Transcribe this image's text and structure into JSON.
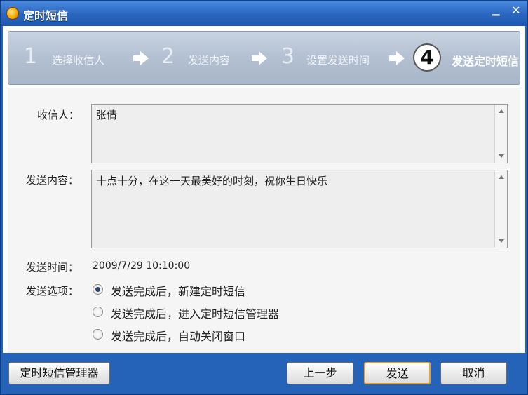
{
  "window": {
    "title": "定时短信",
    "minimize_glyph": "▁",
    "close_glyph": "✕"
  },
  "wizard": {
    "steps": [
      {
        "number": "1",
        "label": "选择收信人"
      },
      {
        "number": "2",
        "label": "发送内容"
      },
      {
        "number": "3",
        "label": "设置发送时间"
      },
      {
        "number": "4",
        "label": "发送定时短信",
        "active": true
      }
    ]
  },
  "form": {
    "recipients_label": "收信人：",
    "recipients_value": "张倩",
    "content_label": "发送内容：",
    "content_value": "十点十分，在这一天最美好的时刻，祝你生日快乐",
    "time_label": "发送时间：",
    "time_value": "2009/7/29 10:10:00",
    "options_label": "发送选项：",
    "options": [
      {
        "label": "发送完成后，新建定时短信",
        "selected": true
      },
      {
        "label": "发送完成后，进入定时短信管理器",
        "selected": false
      },
      {
        "label": "发送完成后，自动关闭窗口",
        "selected": false
      }
    ]
  },
  "buttons": {
    "manager": "定时短信管理器",
    "back": "上一步",
    "send": "发送",
    "cancel": "取消"
  },
  "icons": {
    "app": "app-icon",
    "arrow": "arrow-right-icon",
    "scroll_up": "scroll-up-icon",
    "scroll_down": "scroll-down-icon"
  },
  "colors": {
    "frame": "#2563b8",
    "wizard_band": "#b3c0d2",
    "primary_button_border": "#e0a13a"
  }
}
